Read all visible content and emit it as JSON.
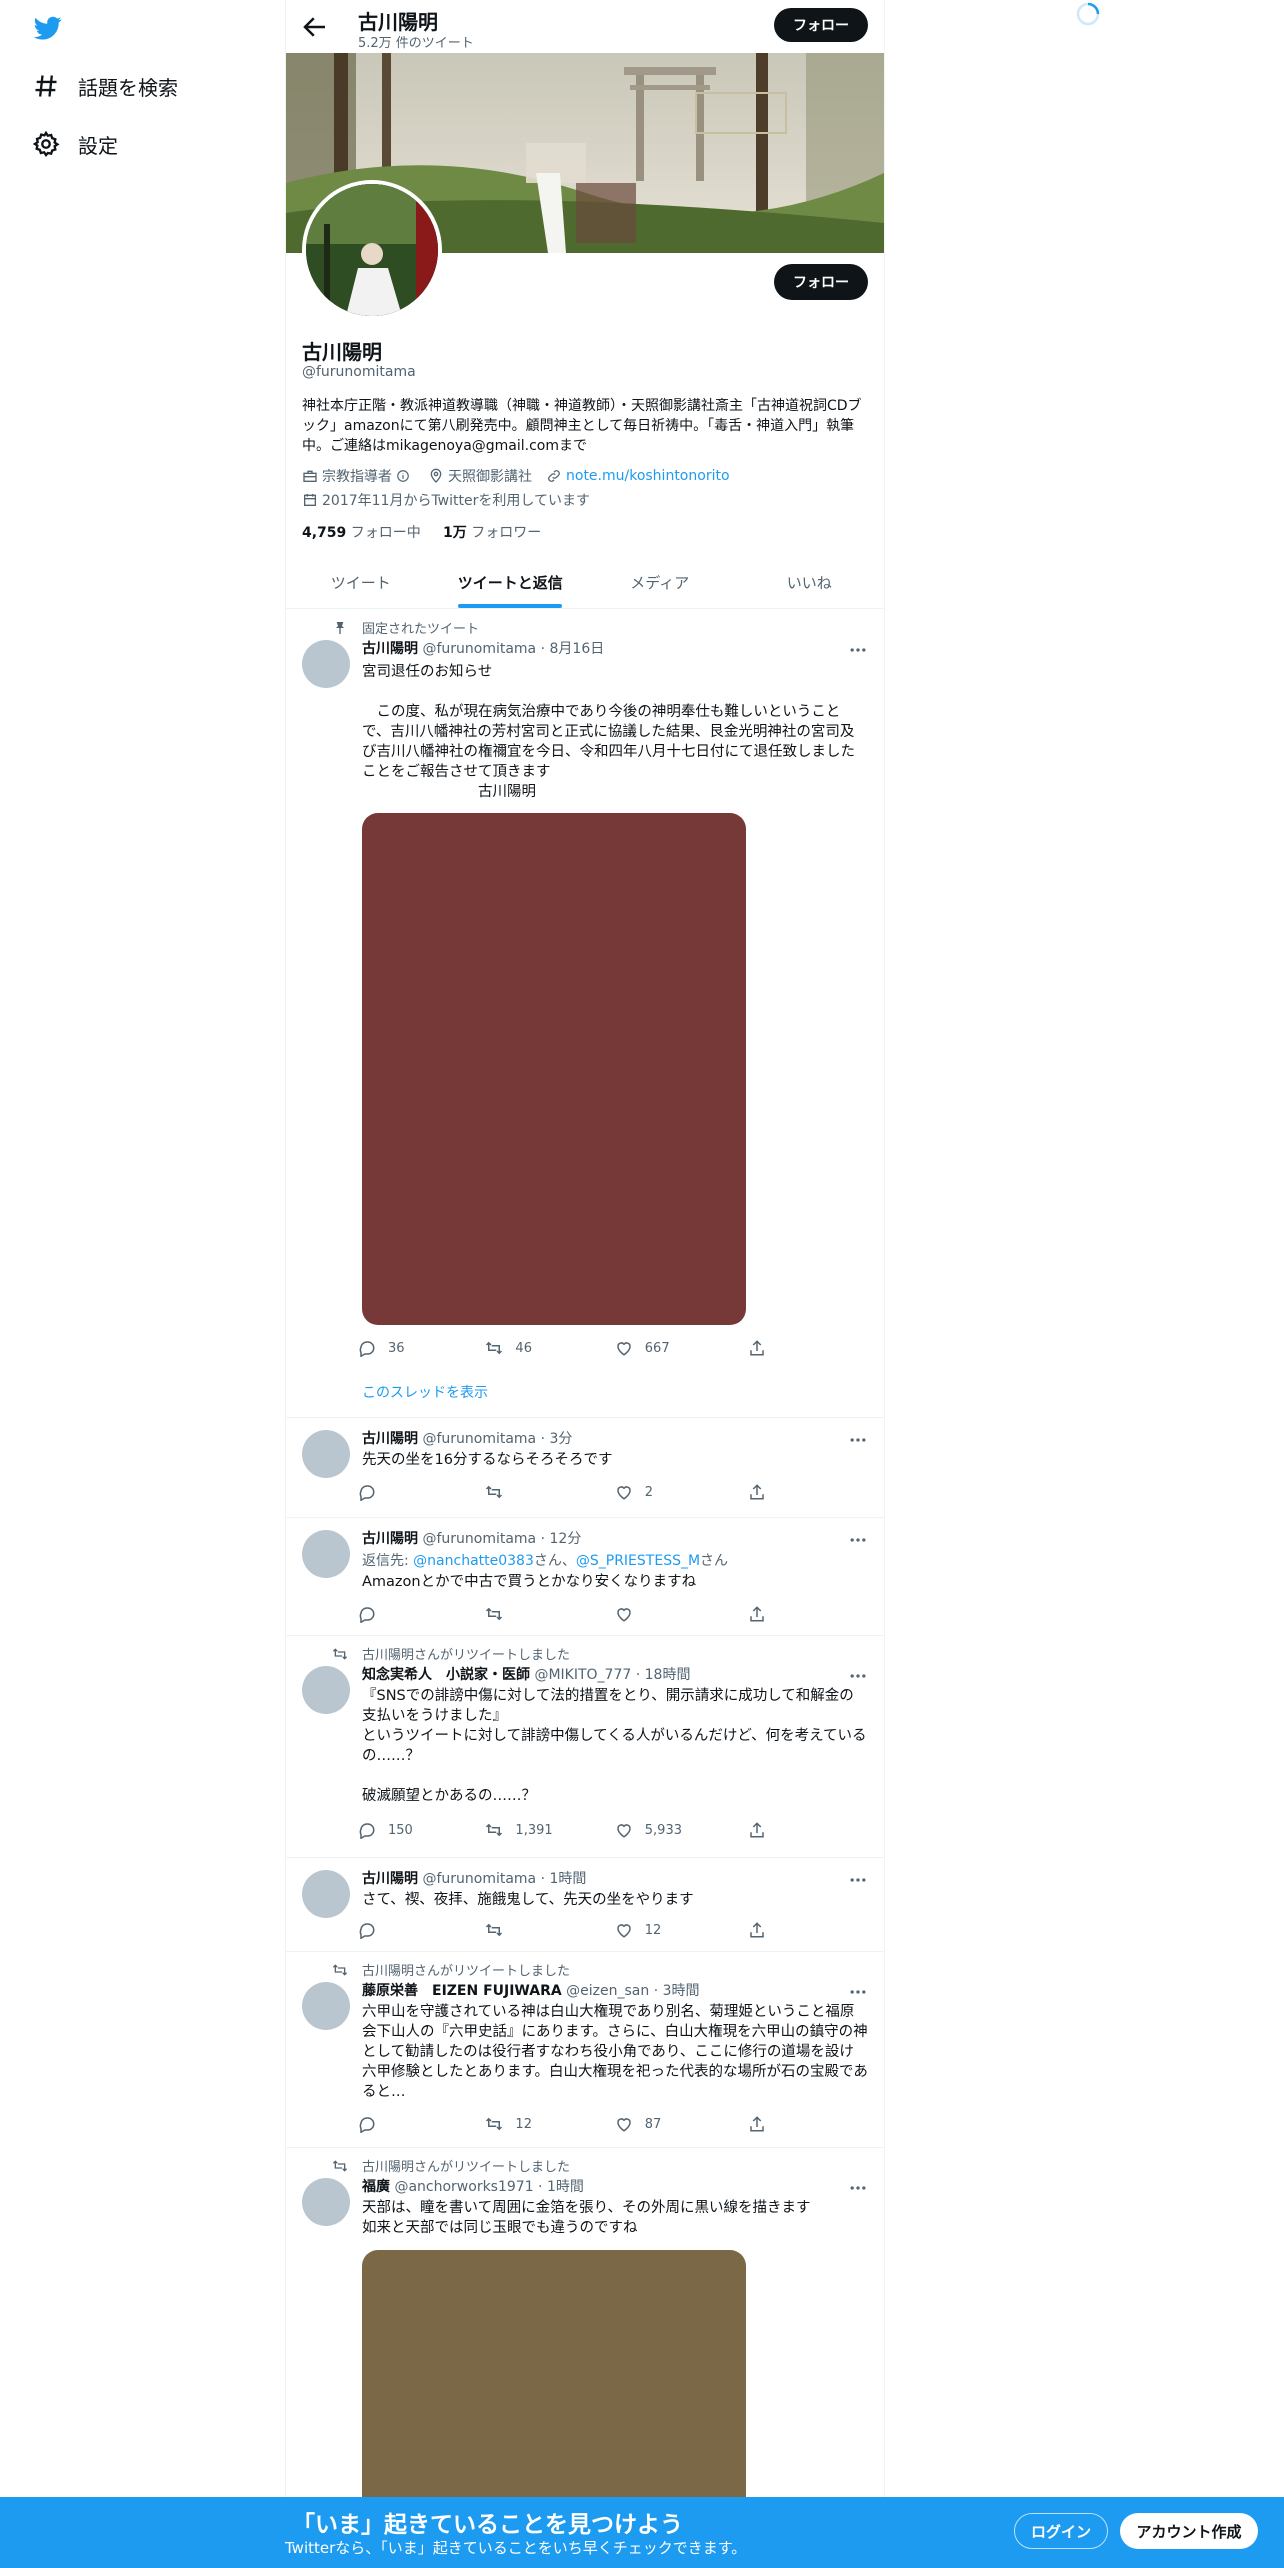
{
  "nav": {
    "items": [
      {
        "label": "話題を検索",
        "icon": "hashtag-icon"
      },
      {
        "label": "設定",
        "icon": "gear-icon"
      }
    ]
  },
  "profile": {
    "name": "古川陽明",
    "tweet_count": "5.2万 件のツイート",
    "handle": "@furunomitama",
    "follow_label": "フォロー",
    "bio": "神社本庁正階・教派神道教導職（神職・神道教師）・天照御影講社斎主「古神道祝詞CDブック」amazonにて第八刷発売中。顧問神主として毎日祈祷中。「毒舌・神道入門」執筆中。ご連絡はmikagenoya@gmail.comまで",
    "category": "宗教指導者",
    "location": "天照御影講社",
    "url": "note.mu/koshintonorito",
    "joined": "2017年11月からTwitterを利用しています",
    "following_count": "4,759",
    "following_label": "フォロー中",
    "followers_count": "1万",
    "followers_label": "フォロワー"
  },
  "tabs": [
    {
      "label": "ツイート",
      "active": false
    },
    {
      "label": "ツイートと返信",
      "active": true
    },
    {
      "label": "メディア",
      "active": false
    },
    {
      "label": "いいね",
      "active": false
    }
  ],
  "tweets": [
    {
      "context": "固定されたツイート",
      "name": "古川陽明",
      "handle": "@furunomitama",
      "time": "8月16日",
      "text": "宮司退任のお知らせ\n\n　この度、私が現在病気治療中であり今後の神明奉仕も難しいということで、吉川八幡神社の芳村宮司と正式に協議した結果、艮金光明神社の宮司及び吉川八幡神社の権禰宜を今日、令和四年八月十七日付にて退任致しましたことをご報告させて頂きます\n　　　　　　　　古川陽明",
      "media_color": "#773838",
      "replies": "36",
      "retweets": "46",
      "likes": "667",
      "thread_link": "このスレッドを表示"
    },
    {
      "name": "古川陽明",
      "handle": "@furunomitama",
      "time": "3分",
      "text": "先天の坐を16分するならそろそろです",
      "replies": "",
      "retweets": "",
      "likes": "2"
    },
    {
      "name": "古川陽明",
      "handle": "@furunomitama",
      "time": "12分",
      "reply_prefix": "返信先: ",
      "reply_to_1": "@nanchatte0383",
      "reply_sep": "さん、",
      "reply_to_2": "@S_PRIESTESS_M",
      "reply_suffix": "さん",
      "text": "Amazonとかで中古で買うとかなり安くなりますね",
      "replies": "",
      "retweets": "",
      "likes": ""
    },
    {
      "context": "古川陽明さんがリツイートしました",
      "name": "知念実希人　小説家・医師",
      "handle": "@MIKITO_777",
      "time": "18時間",
      "text": "『SNSでの誹謗中傷に対して法的措置をとり、開示請求に成功して和解金の支払いをうけました』\nというツイートに対して誹謗中傷してくる人がいるんだけど、何を考えているの……？\n\n破滅願望とかあるの……？",
      "replies": "150",
      "retweets": "1,391",
      "likes": "5,933"
    },
    {
      "name": "古川陽明",
      "handle": "@furunomitama",
      "time": "1時間",
      "text": "さて、禊、夜拝、施餓鬼して、先天の坐をやります",
      "replies": "",
      "retweets": "",
      "likes": "12"
    },
    {
      "context": "古川陽明さんがリツイートしました",
      "name": "藤原栄善　EIZEN FUJIWARA",
      "handle": "@eizen_san",
      "time": "3時間",
      "text": "六甲山を守護されている神は白山大権現であり別名、菊理姫ということ福原会下山人の『六甲史話』にあります。さらに、白山大権現を六甲山の鎮守の神として勧請したのは役行者すなわち役小角であり、ここに修行の道場を設け六甲修験としたとあります。白山大権現を祀った代表的な場所が石の宝殿であると…",
      "replies": "",
      "retweets": "12",
      "likes": "87"
    },
    {
      "context": "古川陽明さんがリツイートしました",
      "name": "福廣",
      "handle": "@anchorworks1971",
      "time": "1時間",
      "text": "天部は、瞳を書いて周囲に金箔を張り、その外周に黒い線を描きます\n如来と天部では同じ玉眼でも違うのですね",
      "media_color": "#7b6847"
    }
  ],
  "bottom_bar": {
    "title": "「いま」起きていることを見つけよう",
    "subtitle": "Twitterなら、「いま」起きていることをいち早くチェックできます。",
    "login": "ログイン",
    "signup": "アカウント作成"
  },
  "colors": {
    "accent": "#1d9bf0",
    "text": "#0f1419",
    "muted": "#536471"
  }
}
